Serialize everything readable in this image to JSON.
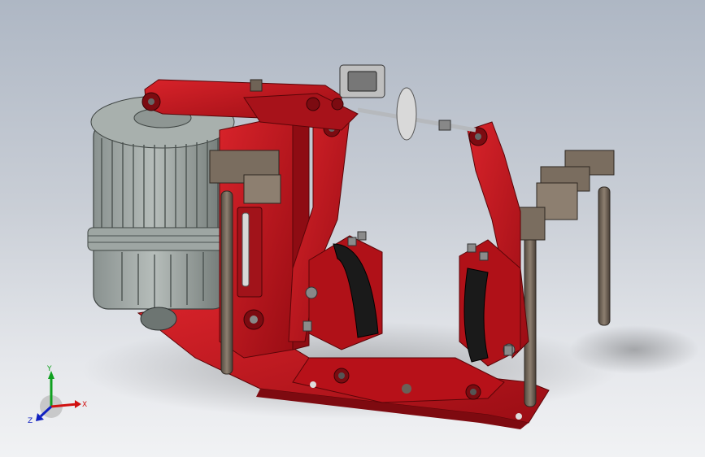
{
  "viewport": {
    "background_top": "#aeb7c4",
    "background_bottom": "#f1f2f4"
  },
  "colors": {
    "frame_red": "#c4141c",
    "frame_red_dark": "#7e0a10",
    "motor_gray": "#9aa3a0",
    "steel_bronze": "#6f6356",
    "lining_black": "#1a1a1a"
  },
  "triad": {
    "x_label": "X",
    "y_label": "Y",
    "z_label": "Z",
    "x_color": "#d01010",
    "y_color": "#10a020",
    "z_color": "#1020c0"
  }
}
